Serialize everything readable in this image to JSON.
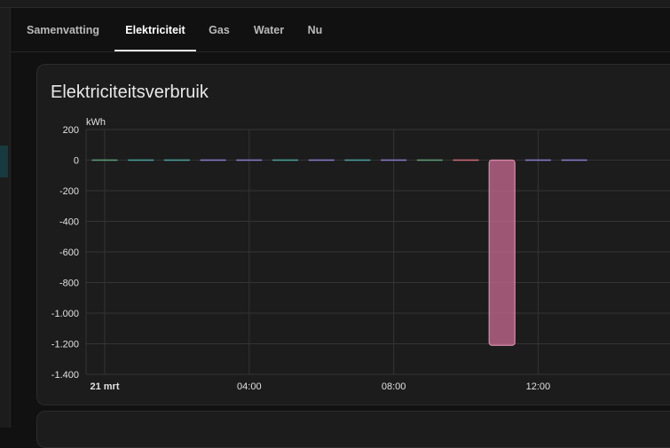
{
  "tabs": [
    {
      "label": "Samenvatting",
      "active": false
    },
    {
      "label": "Elektriciteit",
      "active": true
    },
    {
      "label": "Gas",
      "active": false
    },
    {
      "label": "Water",
      "active": false
    },
    {
      "label": "Nu",
      "active": false
    }
  ],
  "card": {
    "title": "Elektriciteitsverbruik"
  },
  "colors": {
    "bar_pink": "#c86b92",
    "bar_teal": "#4aa3a0",
    "bar_purple": "#8f7ad0",
    "bar_green": "#5da07a",
    "bar_red": "#d46b7a"
  },
  "chart_data": {
    "type": "bar",
    "ylabel": "kWh",
    "ylim": [
      -1400,
      200
    ],
    "yticks": [
      200,
      0,
      -200,
      -400,
      -600,
      -800,
      -1000,
      -1200,
      -1400
    ],
    "ytick_labels": [
      "200",
      "0",
      "-200",
      "-400",
      "-600",
      "-800",
      "-1.000",
      "-1.200",
      "-1.400"
    ],
    "x_tick_labels": [
      "21 mrt",
      "04:00",
      "08:00",
      "12:00"
    ],
    "x_ticks_hours": [
      0,
      4,
      8,
      12
    ],
    "bars": [
      {
        "hour": 0,
        "value": 0,
        "color": "#5da07a"
      },
      {
        "hour": 1,
        "value": 0,
        "color": "#4aa3a0"
      },
      {
        "hour": 2,
        "value": 0,
        "color": "#4aa3a0"
      },
      {
        "hour": 3,
        "value": 0,
        "color": "#8f7ad0"
      },
      {
        "hour": 4,
        "value": 0,
        "color": "#8f7ad0"
      },
      {
        "hour": 5,
        "value": 0,
        "color": "#4aa3a0"
      },
      {
        "hour": 6,
        "value": 0,
        "color": "#8f7ad0"
      },
      {
        "hour": 7,
        "value": 0,
        "color": "#4aa3a0"
      },
      {
        "hour": 8,
        "value": 0,
        "color": "#8f7ad0"
      },
      {
        "hour": 9,
        "value": 0,
        "color": "#5da07a"
      },
      {
        "hour": 10,
        "value": 0,
        "color": "#d46b7a"
      },
      {
        "hour": 11,
        "value": -1210,
        "color": "#c86b92"
      },
      {
        "hour": 12,
        "value": 0,
        "color": "#8f7ad0"
      },
      {
        "hour": 13,
        "value": 0,
        "color": "#8f7ad0"
      }
    ]
  }
}
